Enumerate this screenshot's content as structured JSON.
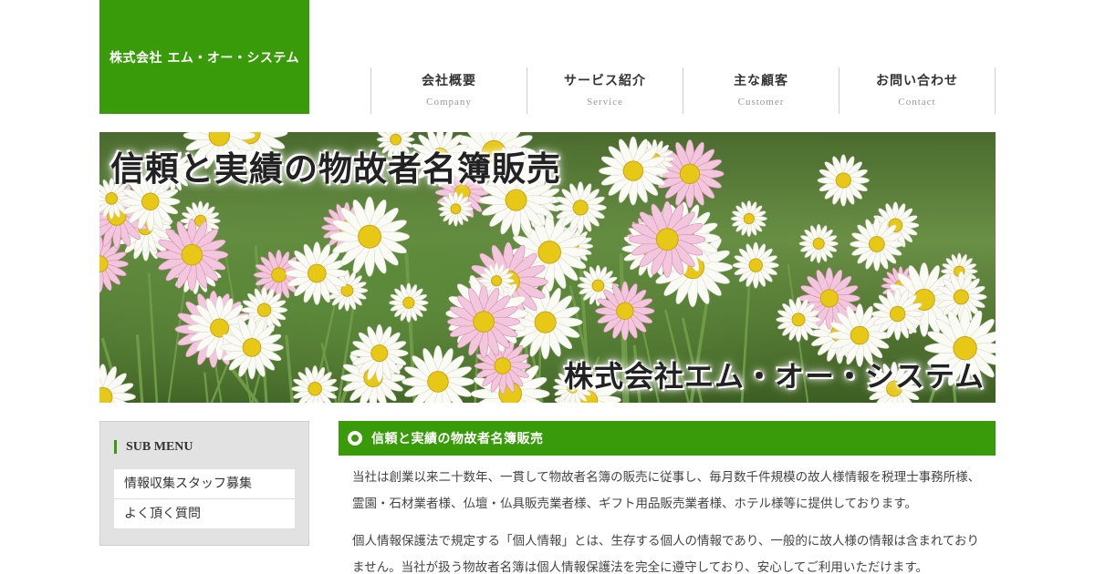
{
  "header": {
    "logo_text": "株式会社 エム・オー・システム"
  },
  "nav": {
    "items": [
      {
        "ja": "会社概要",
        "en": "Company"
      },
      {
        "ja": "サービス紹介",
        "en": "Service"
      },
      {
        "ja": "主な顧客",
        "en": "Customer"
      },
      {
        "ja": "お問い合わせ",
        "en": "Contact"
      }
    ]
  },
  "hero": {
    "title": "信頼と実績の物故者名簿販売",
    "company": "株式会社エム・オー・システム"
  },
  "submenu": {
    "title": "SUB MENU",
    "items": [
      {
        "label": "情報収集スタッフ募集"
      },
      {
        "label": "よく頂く質問"
      }
    ]
  },
  "content": {
    "heading": "信頼と実績の物故者名簿販売",
    "paragraphs": [
      "当社は創業以来二十数年、一貫して物故者名簿の販売に従事し、毎月数千件規模の故人様情報を税理士事務所様、霊園・石材業者様、仏壇・仏具販売業者様、ギフト用品販売業者様、ホテル様等に提供しております。",
      "個人情報保護法で規定する「個人情報」とは、生存する個人の情報であり、一般的に故人様の情報は含まれておりません。当社が扱う物故者名簿は個人情報保護法を完全に遵守しており、安心してご利用いただけます。"
    ]
  },
  "colors": {
    "brand_green": "#3a9b0a",
    "submenu_bg": "#e2e2e2"
  }
}
